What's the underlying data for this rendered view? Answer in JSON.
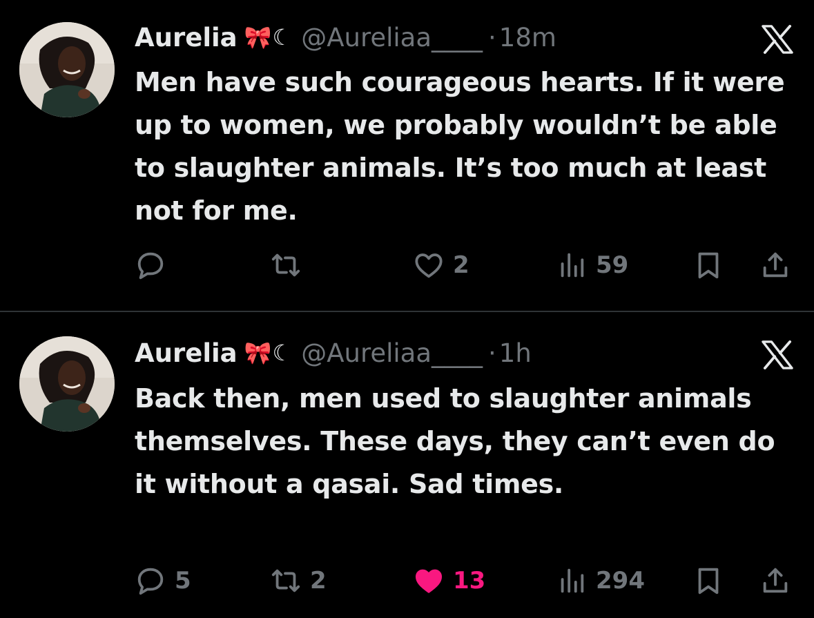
{
  "tweets": [
    {
      "display_name": "Aurelia",
      "name_emoji": "🎀☾",
      "handle": "@Aureliaa____",
      "dot": "·",
      "time": "18m",
      "text": "Men have such courageous hearts. If it were up to women, we probably wouldn’t be able to slaughter animals. It’s too much at least not for me.",
      "replies": "",
      "retweets": "",
      "likes": "2",
      "liked": false,
      "views": "59"
    },
    {
      "display_name": "Aurelia",
      "name_emoji": "🎀☾",
      "handle": "@Aureliaa____",
      "dot": "·",
      "time": "1h",
      "text": "Back then, men used to slaughter animals themselves. These days, they can’t even do it without a qasai. Sad times.",
      "replies": "5",
      "retweets": "2",
      "likes": "13",
      "liked": true,
      "views": "294"
    }
  ],
  "icons": {
    "avatar": "avatar-photo",
    "platform": "x-logo-icon",
    "reply": "reply-icon",
    "retweet": "retweet-icon",
    "like": "heart-icon",
    "views": "views-icon",
    "bookmark": "bookmark-icon",
    "share": "share-icon"
  },
  "colors": {
    "background": "#000000",
    "text_primary": "#e7e9ea",
    "text_secondary": "#71767b",
    "like_active": "#f91880",
    "divider": "#2f3336"
  }
}
